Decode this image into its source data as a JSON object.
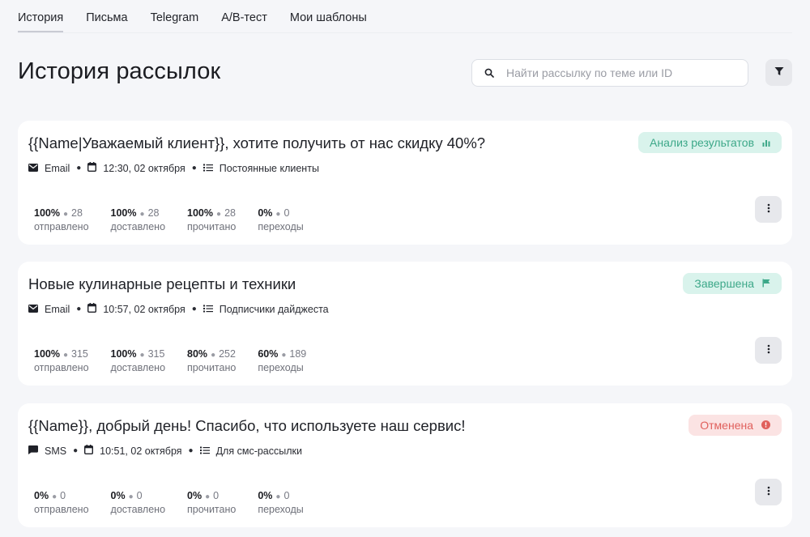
{
  "tabs": [
    {
      "label": "История",
      "active": true
    },
    {
      "label": "Письма",
      "active": false
    },
    {
      "label": "Telegram",
      "active": false
    },
    {
      "label": "A/B-тест",
      "active": false
    },
    {
      "label": "Мои шаблоны",
      "active": false
    }
  ],
  "header": {
    "title": "История рассылок",
    "search_placeholder": "Найти рассылку по теме или ID"
  },
  "colors": {
    "status_green": "#3da889",
    "status_green_bg": "#d9f3ec",
    "status_red": "#e0605c",
    "status_red_bg": "#fbe3e3"
  },
  "campaigns": [
    {
      "title": "{{Name|Уважаемый клиент}}, хотите получить от нас скидку 40%?",
      "channel": "Email",
      "channel_icon": "envelope-icon",
      "datetime": "12:30, 02 октября",
      "audience": "Постоянные клиенты",
      "status": "Анализ результатов",
      "status_icon": "bar-chart-icon",
      "stats": [
        {
          "pct": "100%",
          "count": "28",
          "label": "отправлено"
        },
        {
          "pct": "100%",
          "count": "28",
          "label": "доставлено"
        },
        {
          "pct": "100%",
          "count": "28",
          "label": "прочитано"
        },
        {
          "pct": "0%",
          "count": "0",
          "label": "переходы"
        }
      ]
    },
    {
      "title": "Новые кулинарные рецепты и техники",
      "channel": "Email",
      "channel_icon": "envelope-icon",
      "datetime": "10:57, 02 октября",
      "audience": "Подписчики дайджеста",
      "status": "Завершена",
      "status_icon": "flag-icon",
      "stats": [
        {
          "pct": "100%",
          "count": "315",
          "label": "отправлено"
        },
        {
          "pct": "100%",
          "count": "315",
          "label": "доставлено"
        },
        {
          "pct": "80%",
          "count": "252",
          "label": "прочитано"
        },
        {
          "pct": "60%",
          "count": "189",
          "label": "переходы"
        }
      ]
    },
    {
      "title": "{{Name}}, добрый день! Спасибо, что используете наш сервис!",
      "channel": "SMS",
      "channel_icon": "chat-bubble-icon",
      "datetime": "10:51, 02 октября",
      "audience": "Для смс-рассылки",
      "status": "Отменена",
      "status_icon": "alert-circle-icon",
      "stats": [
        {
          "pct": "0%",
          "count": "0",
          "label": "отправлено"
        },
        {
          "pct": "0%",
          "count": "0",
          "label": "доставлено"
        },
        {
          "pct": "0%",
          "count": "0",
          "label": "прочитано"
        },
        {
          "pct": "0%",
          "count": "0",
          "label": "переходы"
        }
      ]
    }
  ]
}
